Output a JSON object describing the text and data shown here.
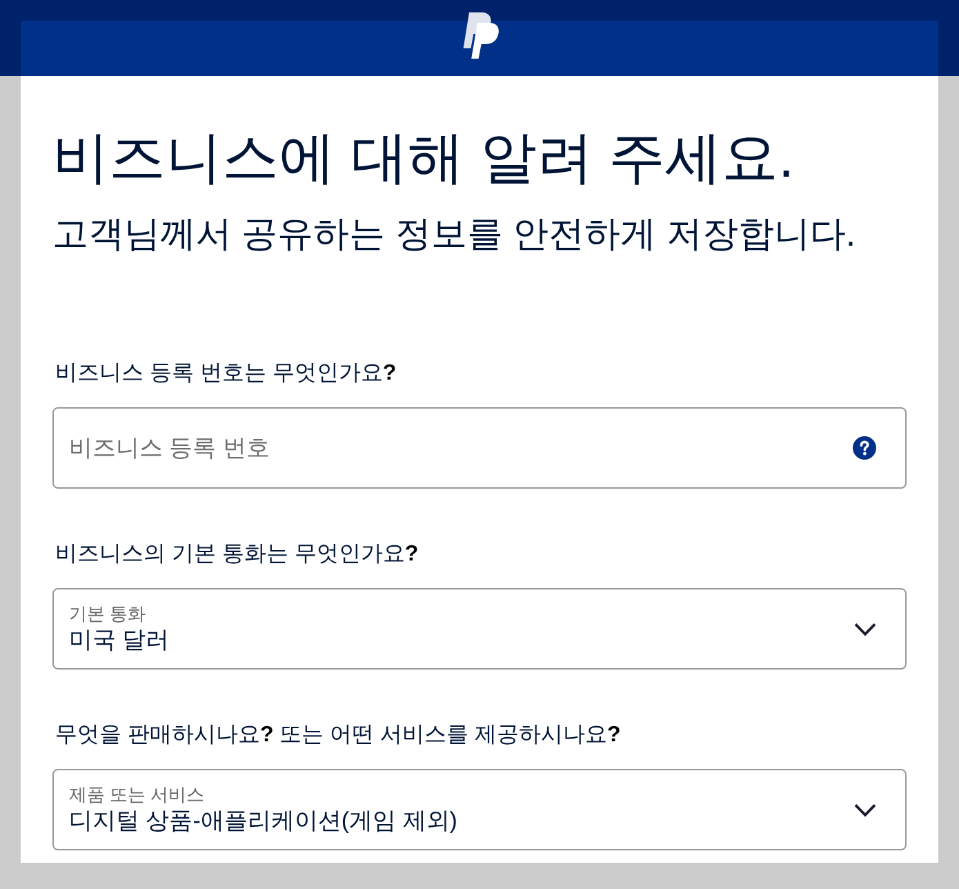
{
  "heading": "비즈니스에 대해 알려 주세요.",
  "subheading": "고객님께서 공유하는 정보를 안전하게 저장합니다.",
  "fields": [
    {
      "kind": "text",
      "question": "비즈니스 등록 번호는 무엇인가요**?**",
      "placeholder": "비즈니스 등록 번호"
    },
    {
      "kind": "select",
      "question": "비즈니스의 기본 통화는 무엇인가요**?**",
      "label": "기본 통화",
      "value": "미국 달러"
    },
    {
      "kind": "select",
      "question": "무엇을 판매하시나요**?** 또는 어떤 서비스를 제공하시나요**?**",
      "label": "제품 또는 서비스",
      "value": "디지털 상품-애플리케이션(게임 제외)"
    }
  ]
}
